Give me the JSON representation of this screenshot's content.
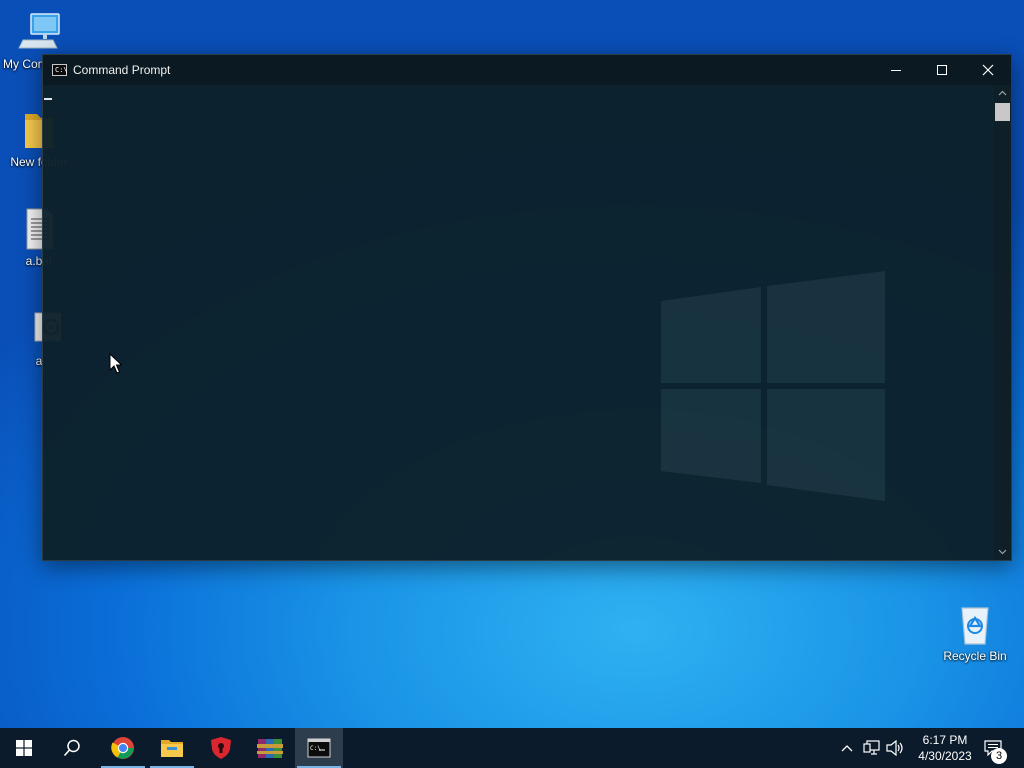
{
  "desktop": {
    "icons": [
      {
        "label": "My Computer",
        "icon": "computer-icon"
      },
      {
        "label": "New folder",
        "icon": "folder-icon"
      },
      {
        "label": "a.bat",
        "icon": "batch-file-icon"
      },
      {
        "label": "a",
        "icon": "settings-file-icon"
      },
      {
        "label": "Recycle Bin",
        "icon": "recycle-bin-icon"
      }
    ]
  },
  "window": {
    "title": "Command Prompt",
    "icon": "cmd-icon",
    "controls": {
      "minimize": "minimize-icon",
      "maximize": "maximize-icon",
      "close": "close-icon"
    }
  },
  "taskbar": {
    "pinned": [
      {
        "name": "Start",
        "icon": "windows-logo-icon"
      },
      {
        "name": "Search",
        "icon": "search-icon"
      },
      {
        "name": "Google Chrome",
        "icon": "chrome-icon"
      },
      {
        "name": "File Explorer",
        "icon": "folder-icon"
      },
      {
        "name": "Security",
        "icon": "shield-icon"
      },
      {
        "name": "WinRAR",
        "icon": "archive-icon"
      },
      {
        "name": "Command Prompt",
        "icon": "cmd-icon"
      }
    ],
    "tray": {
      "clock_time": "6:17 PM",
      "clock_date": "4/30/2023",
      "notification_count": "3"
    }
  },
  "colors": {
    "taskbar": "#0b1b2b",
    "window_bg": "#0c202a",
    "accent_underline": "#78b4e6"
  }
}
